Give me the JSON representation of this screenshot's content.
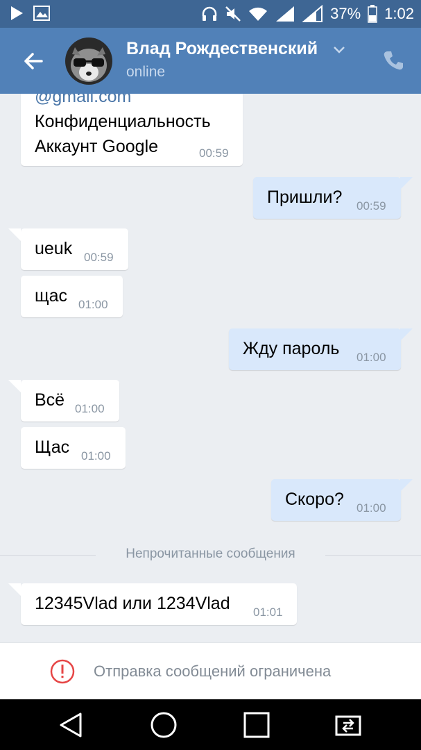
{
  "status_bar": {
    "battery": "37%",
    "time": "1:02"
  },
  "header": {
    "name": "Влад Рождественский",
    "status": "online"
  },
  "messages": [
    {
      "lines": [
        "@gmail.com",
        "Конфиденциальность",
        "Аккаунт Google"
      ],
      "time": "00:59",
      "direction": "in"
    },
    {
      "text": "Пришли?",
      "time": "00:59",
      "direction": "out"
    },
    {
      "text": "ueuk",
      "time": "00:59",
      "direction": "in"
    },
    {
      "text": "щас",
      "time": "01:00",
      "direction": "in"
    },
    {
      "text": "Жду пароль",
      "time": "01:00",
      "direction": "out"
    },
    {
      "text": "Всё",
      "time": "01:00",
      "direction": "in"
    },
    {
      "text": "Щас",
      "time": "01:00",
      "direction": "in"
    },
    {
      "text": "Скоро?",
      "time": "01:00",
      "direction": "out"
    },
    {
      "text": "12345Vlad или 1234Vlad",
      "time": "01:01",
      "direction": "in"
    }
  ],
  "separator": "Непрочитанные сообщения",
  "restricted": {
    "text": "Отправка сообщений ограничена"
  },
  "colors": {
    "header": "#5181b8",
    "status_bar": "#3e6694",
    "incoming": "#ffffff",
    "outgoing": "#d9e8fb",
    "background": "#ebeef2"
  },
  "icons": [
    "play-icon",
    "image-icon",
    "headphones-icon",
    "mute-icon",
    "wifi-icon",
    "signal-icon",
    "battery-icon",
    "back-arrow-icon",
    "chevron-down-icon",
    "phone-icon",
    "alert-icon",
    "nav-back-icon",
    "nav-home-icon",
    "nav-recents-icon",
    "screen-rotate-icon"
  ]
}
